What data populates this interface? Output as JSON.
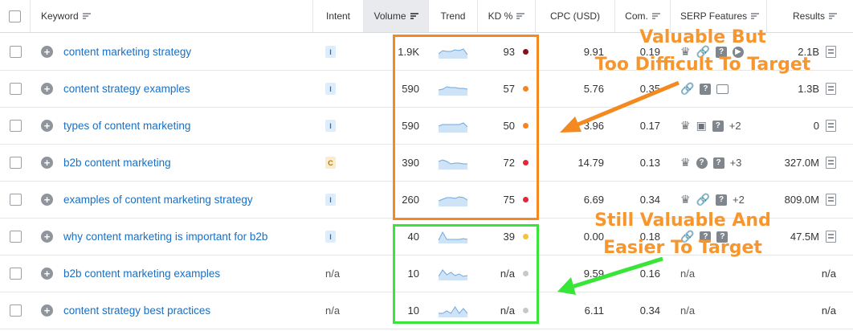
{
  "table": {
    "headers": {
      "keyword": "Keyword",
      "intent": "Intent",
      "volume": "Volume",
      "trend": "Trend",
      "kd": "KD %",
      "cpc": "CPC (USD)",
      "com": "Com.",
      "serp": "SERP Features",
      "results": "Results"
    },
    "rows": [
      {
        "keyword": "content marketing strategy",
        "intent": "I",
        "volume": "1.9K",
        "trend": [
          10,
          6,
          7,
          7,
          5,
          6,
          4,
          11
        ],
        "kd": "93",
        "kd_color": "#8b0d1e",
        "cpc": "9.91",
        "com": "0.19",
        "serp": [
          "crown-icon",
          "link-icon",
          "question-icon",
          "play-icon"
        ],
        "serp_more": "",
        "results": "2.1B"
      },
      {
        "keyword": "content strategy examples",
        "intent": "I",
        "volume": "590",
        "trend": [
          9,
          8,
          5,
          6,
          6,
          7,
          7,
          8
        ],
        "kd": "57",
        "kd_color": "#f6851f",
        "cpc": "5.76",
        "com": "0.35",
        "serp": [
          "link-icon",
          "question-icon",
          "image-icon"
        ],
        "serp_more": "",
        "results": "1.3B"
      },
      {
        "keyword": "types of content marketing",
        "intent": "I",
        "volume": "590",
        "trend": [
          8,
          6,
          6,
          6,
          6,
          6,
          4,
          9
        ],
        "kd": "50",
        "kd_color": "#f6851f",
        "cpc": "3.96",
        "com": "0.17",
        "serp": [
          "crown-icon",
          "video-icon",
          "question-icon"
        ],
        "serp_more": "+2",
        "results": "0"
      },
      {
        "keyword": "b2b content marketing",
        "intent": "C",
        "volume": "390",
        "trend": [
          6,
          4,
          6,
          9,
          8,
          8,
          9,
          9
        ],
        "kd": "72",
        "kd_color": "#e0283a",
        "cpc": "14.79",
        "com": "0.13",
        "serp": [
          "crown-icon",
          "help-icon",
          "question-icon"
        ],
        "serp_more": "+3",
        "results": "327.0M"
      },
      {
        "keyword": "examples of content marketing strategy",
        "intent": "I",
        "volume": "260",
        "trend": [
          9,
          7,
          5,
          5,
          6,
          4,
          5,
          8
        ],
        "kd": "75",
        "kd_color": "#e0283a",
        "cpc": "6.69",
        "com": "0.34",
        "serp": [
          "crown-icon",
          "link-icon",
          "question-icon"
        ],
        "serp_more": "+2",
        "results": "809.0M"
      },
      {
        "keyword": "why content marketing is important for b2b",
        "intent": "I",
        "volume": "40",
        "trend": [
          12,
          2,
          11,
          11,
          11,
          11,
          10,
          11
        ],
        "kd": "39",
        "kd_color": "#f6c23c",
        "cpc": "0.00",
        "com": "0.18",
        "serp": [
          "link-icon",
          "question-icon",
          "question-icon"
        ],
        "serp_more": "",
        "results": "47.5M"
      },
      {
        "keyword": "b2b content marketing examples",
        "intent": "n/a",
        "volume": "10",
        "trend": [
          11,
          3,
          9,
          6,
          10,
          8,
          11,
          10
        ],
        "kd": "n/a",
        "kd_color": "#c8c8c8",
        "cpc": "9.59",
        "com": "0.16",
        "serp": [],
        "serp_more": "n/a",
        "results": "n/a"
      },
      {
        "keyword": "content strategy best practices",
        "intent": "n/a",
        "volume": "10",
        "trend": [
          11,
          11,
          8,
          11,
          3,
          11,
          5,
          11
        ],
        "kd": "n/a",
        "kd_color": "#c8c8c8",
        "cpc": "6.11",
        "com": "0.34",
        "serp": [],
        "serp_more": "n/a",
        "results": "n/a"
      }
    ]
  },
  "annotations": {
    "top_line1": "Valuable But",
    "top_line2": "Too Difficult To Target",
    "bottom_line1": "Still Valuable And",
    "bottom_line2": "Easier To Target"
  },
  "colors": {
    "orange": "#f4891f",
    "green": "#39e539",
    "link": "#1a6fc2"
  }
}
